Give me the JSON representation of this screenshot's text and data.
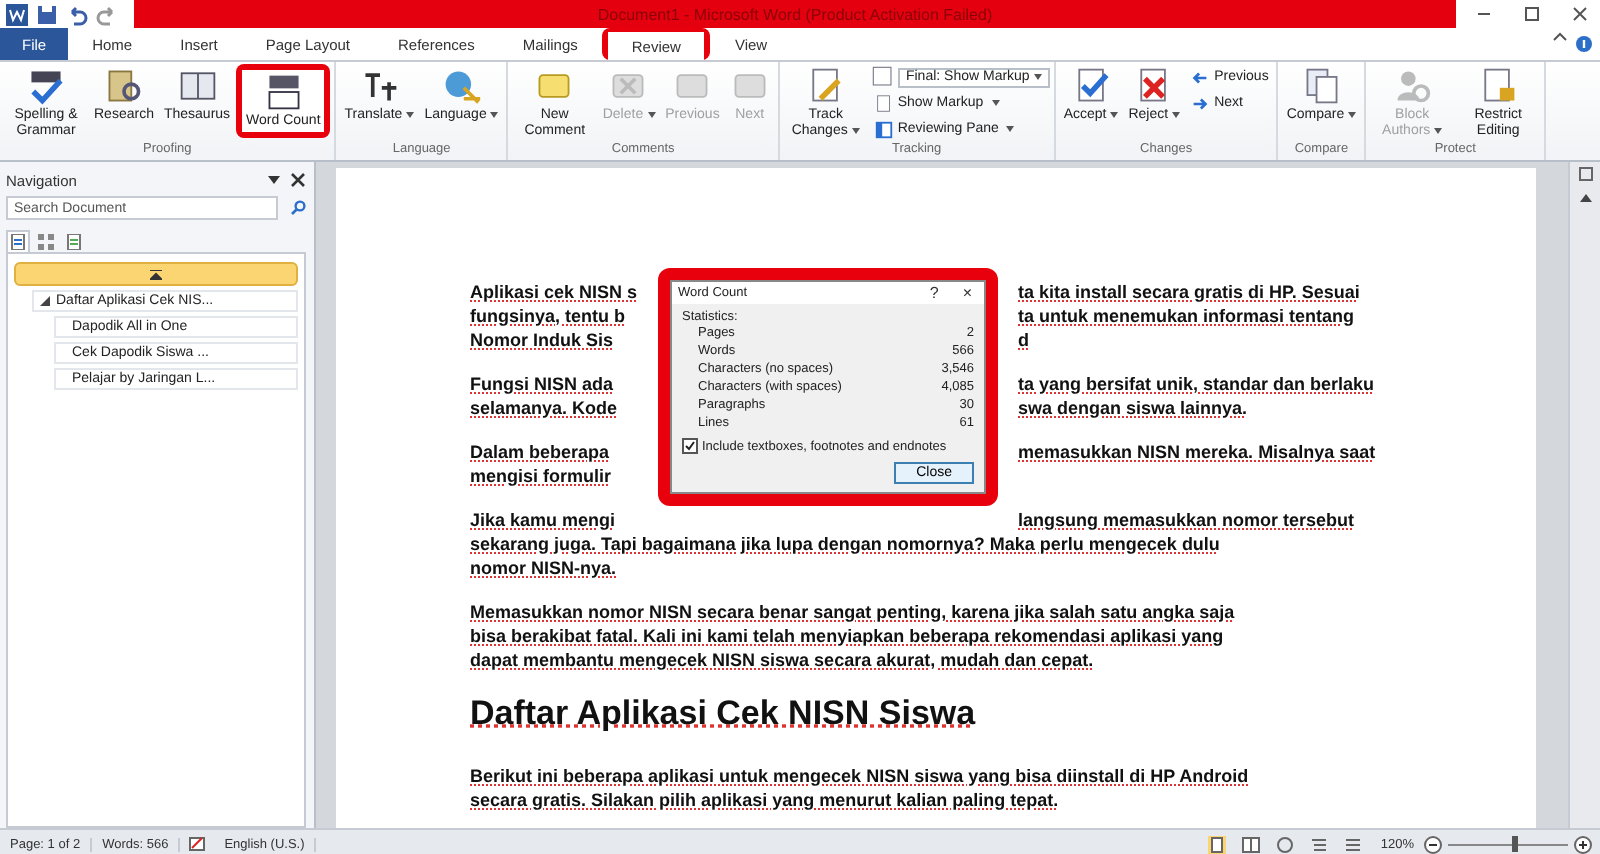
{
  "title_bar": {
    "title": "Document1 - Microsoft Word (Product Activation Failed)"
  },
  "ribbon_tabs": [
    {
      "label": "File",
      "kind": "file",
      "selected": false,
      "highlighted": false
    },
    {
      "label": "Home",
      "kind": "tab",
      "selected": false,
      "highlighted": false
    },
    {
      "label": "Insert",
      "kind": "tab",
      "selected": false,
      "highlighted": false
    },
    {
      "label": "Page Layout",
      "kind": "tab",
      "selected": false,
      "highlighted": false
    },
    {
      "label": "References",
      "kind": "tab",
      "selected": false,
      "highlighted": false
    },
    {
      "label": "Mailings",
      "kind": "tab",
      "selected": false,
      "highlighted": false
    },
    {
      "label": "Review",
      "kind": "tab",
      "selected": true,
      "highlighted": true
    },
    {
      "label": "View",
      "kind": "tab",
      "selected": false,
      "highlighted": false
    }
  ],
  "ribbon_groups": [
    {
      "label": "Proofing",
      "buttons": [
        {
          "label": "Spelling & Grammar",
          "kind": "large",
          "disabled": false,
          "dropdown": false,
          "highlighted": false
        },
        {
          "label": "Research",
          "kind": "large",
          "disabled": false,
          "dropdown": false,
          "highlighted": false
        },
        {
          "label": "Thesaurus",
          "kind": "large",
          "disabled": false,
          "dropdown": false,
          "highlighted": false
        },
        {
          "label": "Word Count",
          "kind": "large",
          "disabled": false,
          "dropdown": false,
          "highlighted": true
        }
      ]
    },
    {
      "label": "Language",
      "buttons": [
        {
          "label": "Translate",
          "kind": "large",
          "disabled": false,
          "dropdown": true,
          "highlighted": false
        },
        {
          "label": "Language",
          "kind": "large",
          "disabled": false,
          "dropdown": true,
          "highlighted": false
        }
      ]
    },
    {
      "label": "Comments",
      "buttons": [
        {
          "label": "New Comment",
          "kind": "large",
          "disabled": false,
          "dropdown": false,
          "highlighted": false
        },
        {
          "label": "Delete",
          "kind": "large",
          "disabled": true,
          "dropdown": true,
          "highlighted": false
        },
        {
          "label": "Previous",
          "kind": "large",
          "disabled": true,
          "dropdown": false,
          "highlighted": false
        },
        {
          "label": "Next",
          "kind": "large",
          "disabled": true,
          "dropdown": false,
          "highlighted": false
        }
      ]
    },
    {
      "label": "Tracking",
      "buttons": [
        {
          "label": "Track Changes",
          "kind": "large",
          "disabled": false,
          "dropdown": true,
          "highlighted": false
        },
        {
          "label": "Final: Show Markup",
          "kind": "select",
          "disabled": false,
          "dropdown": true,
          "highlighted": false
        },
        {
          "label": "Show Markup",
          "kind": "small",
          "disabled": false,
          "dropdown": true,
          "highlighted": false
        },
        {
          "label": "Reviewing Pane",
          "kind": "small",
          "disabled": false,
          "dropdown": true,
          "highlighted": false
        }
      ]
    },
    {
      "label": "Changes",
      "buttons": [
        {
          "label": "Accept",
          "kind": "large",
          "disabled": false,
          "dropdown": true,
          "highlighted": false
        },
        {
          "label": "Reject",
          "kind": "large",
          "disabled": false,
          "dropdown": true,
          "highlighted": false
        },
        {
          "label": "Previous",
          "kind": "small",
          "disabled": false,
          "dropdown": false,
          "highlighted": false
        },
        {
          "label": "Next",
          "kind": "small",
          "disabled": false,
          "dropdown": false,
          "highlighted": false
        }
      ]
    },
    {
      "label": "Compare",
      "buttons": [
        {
          "label": "Compare",
          "kind": "large",
          "disabled": false,
          "dropdown": true,
          "highlighted": false
        }
      ]
    },
    {
      "label": "Protect",
      "buttons": [
        {
          "label": "Block Authors",
          "kind": "large",
          "disabled": true,
          "dropdown": true,
          "highlighted": false
        },
        {
          "label": "Restrict Editing",
          "kind": "large",
          "disabled": false,
          "dropdown": false,
          "highlighted": false
        }
      ]
    }
  ],
  "navigation": {
    "title": "Navigation",
    "search": {
      "placeholder": "Search Document"
    },
    "view_tabs": [
      {
        "selected": true
      },
      {
        "selected": false
      },
      {
        "selected": false
      }
    ],
    "headings": [
      {
        "label": "Daftar Aplikasi Cek NIS...",
        "expanded": true,
        "children": [
          {
            "label": "Dapodik All in One"
          },
          {
            "label": "Cek Dapodik Siswa ..."
          },
          {
            "label": "Pelajar by Jaringan L..."
          }
        ]
      }
    ]
  },
  "document": {
    "blocks": [
      {
        "kind": "paragraph",
        "lines": [
          [
            "Aplikasi cek NISN s",
            "ta kita install secara gratis di HP. Sesuai"
          ],
          [
            "fungsinya, tentu b",
            "ta untuk menemukan informasi tentang"
          ],
          [
            "Nomor Induk Sis",
            "d"
          ]
        ]
      },
      {
        "kind": "paragraph",
        "lines": [
          [
            "Fungsi NISN ada",
            "ta yang bersifat unik, standar dan berlaku"
          ],
          [
            "selamanya. Kode",
            "swa dengan siswa lainnya."
          ]
        ]
      },
      {
        "kind": "paragraph",
        "lines": [
          [
            "Dalam beberapa",
            "memasukkan NISN mereka. Misalnya saat"
          ],
          [
            "mengisi formulir"
          ]
        ]
      },
      {
        "kind": "paragraph",
        "lines": [
          [
            "Jika kamu mengi",
            "langsung memasukkan nomor tersebut"
          ],
          [
            "sekarang juga. Tapi bagaimana jika lupa dengan nomornya? Maka perlu mengecek dulu"
          ],
          [
            "nomor NISN-nya."
          ]
        ]
      },
      {
        "kind": "paragraph",
        "lines": [
          [
            "Memasukkan nomor NISN secara benar sangat penting, karena jika salah satu angka saja"
          ],
          [
            "bisa berakibat fatal. Kali ini kami telah menyiapkan beberapa rekomendasi aplikasi yang"
          ],
          [
            "dapat membantu mengecek NISN siswa secara akurat, mudah dan cepat."
          ]
        ]
      },
      {
        "kind": "heading",
        "lines": [
          [
            "Daftar Aplikasi Cek NISN Siswa"
          ]
        ]
      },
      {
        "kind": "paragraph",
        "lines": [
          [
            "Berikut ini beberapa aplikasi untuk mengecek NISN siswa yang bisa diinstall di HP Android"
          ],
          [
            "secara gratis. Silakan pilih aplikasi yang menurut kalian paling tepat."
          ]
        ]
      }
    ]
  },
  "word_count_dialog": {
    "title": "Word Count",
    "help": "?",
    "close": "×",
    "highlighted": true,
    "section": "Statistics:",
    "stats": [
      {
        "label": "Pages",
        "value": "2"
      },
      {
        "label": "Words",
        "value": "566"
      },
      {
        "label": "Characters (no spaces)",
        "value": "3,546"
      },
      {
        "label": "Characters (with spaces)",
        "value": "4,085"
      },
      {
        "label": "Paragraphs",
        "value": "30"
      },
      {
        "label": "Lines",
        "value": "61"
      }
    ],
    "include_option": {
      "label": "Include textboxes, footnotes and endnotes",
      "checked": true
    },
    "button": "Close"
  },
  "status_bar": {
    "page": "Page: 1 of 2",
    "words": "Words: 566",
    "language": "English (U.S.)",
    "zoom": "120%",
    "zoom_level": {
      "level": 0.55
    }
  }
}
